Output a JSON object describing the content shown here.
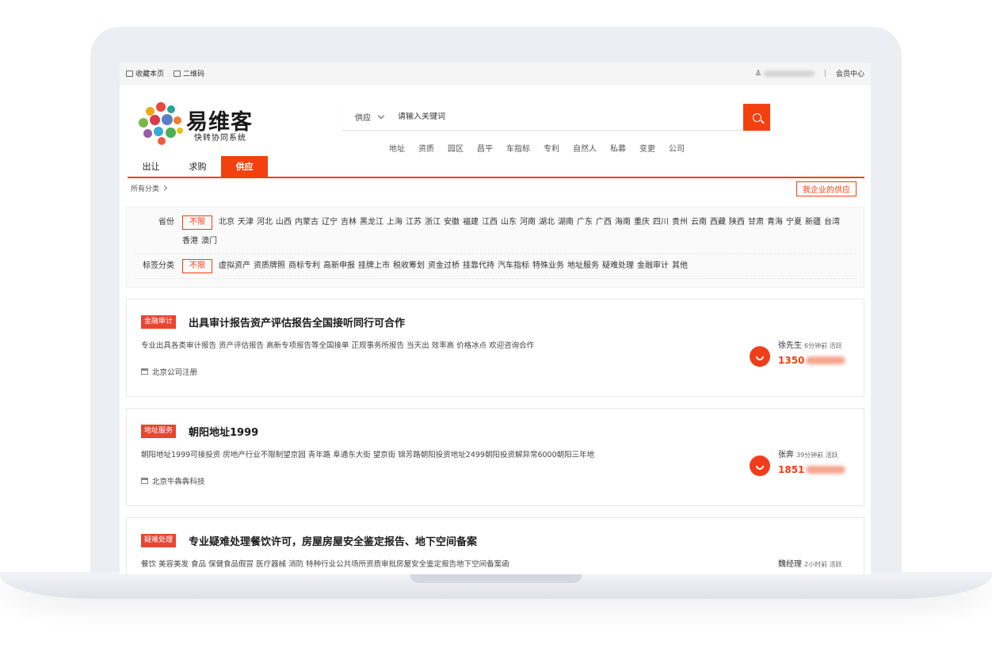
{
  "topbar": {
    "bookmark": "收藏本页",
    "qrcode": "二维码",
    "separator": "|",
    "member_center": "会员中心"
  },
  "brand": {
    "name": "易维客",
    "subtitle": "快转协同系统"
  },
  "search": {
    "category": "供应",
    "placeholder": "请输入关键词"
  },
  "hotwords": [
    "地址",
    "资质",
    "园区",
    "昌平",
    "车指标",
    "专利",
    "自然人",
    "私募",
    "变更",
    "公司"
  ],
  "tabs": [
    {
      "label": "出让",
      "active": false
    },
    {
      "label": "求购",
      "active": false
    },
    {
      "label": "供应",
      "active": true
    }
  ],
  "breadcrumb": "所有分类",
  "my_supply_button": "我企业的供应",
  "filters": {
    "province": {
      "label": "省份",
      "selected": "不限",
      "options": [
        "北京",
        "天津",
        "河北",
        "山西",
        "内蒙古",
        "辽宁",
        "吉林",
        "黑龙江",
        "上海",
        "江苏",
        "浙江",
        "安徽",
        "福建",
        "江西",
        "山东",
        "河南",
        "湖北",
        "湖南",
        "广东",
        "广西",
        "海南",
        "重庆",
        "四川",
        "贵州",
        "云南",
        "西藏",
        "陕西",
        "甘肃",
        "青海",
        "宁夏",
        "新疆",
        "台湾",
        "香港",
        "澳门"
      ]
    },
    "tags": {
      "label": "标签分类",
      "selected": "不限",
      "options": [
        "虚拟资产",
        "资质牌照",
        "商标专利",
        "高新申报",
        "挂牌上市",
        "税收筹划",
        "资金过桥",
        "挂靠代持",
        "汽车指标",
        "特殊业务",
        "地址服务",
        "疑难处理",
        "金融审计",
        "其他"
      ]
    }
  },
  "listings": [
    {
      "tag": "金融审计",
      "title": "出具审计报告资产评估报告全国接听同行可合作",
      "desc": "专业出具各类审计报告 资产评估报告 高新专项报告等全国接单 正规事务所报告 当天出 效率高 价格冰点 欢迎咨询合作",
      "company": "北京公司注册",
      "contact": "徐先生",
      "active_time": "6分钟前 活跃",
      "phone_prefix": "1350"
    },
    {
      "tag": "地址服务",
      "title": "朝阳地址1999",
      "desc": "朝阳地址1999可接投资 房地产行业不限制望京园 青年路 阜通东大街 望京街 锦芳路朝阳投资地址2499朝阳投资解异常6000朝阳三年地",
      "company": "北京牛犇犇科技",
      "contact": "张奔",
      "active_time": "39分钟前 活跃",
      "phone_prefix": "1851"
    },
    {
      "tag": "疑难处理",
      "title": "专业疑难处理餐饮许可，房屋房屋安全鉴定报告、地下空间备案",
      "desc": "餐饮 美容美发 食品 保健食品假冒 医疗器械 消防 特种行业公共场所资质审批房屋安全鉴定报告地下空间备案函",
      "company": "",
      "contact": "魏经理",
      "active_time": "2小时前 活跃",
      "phone_prefix": ""
    }
  ],
  "colors": {
    "accent": "#f2400f",
    "tag_bg": "#e84532"
  }
}
